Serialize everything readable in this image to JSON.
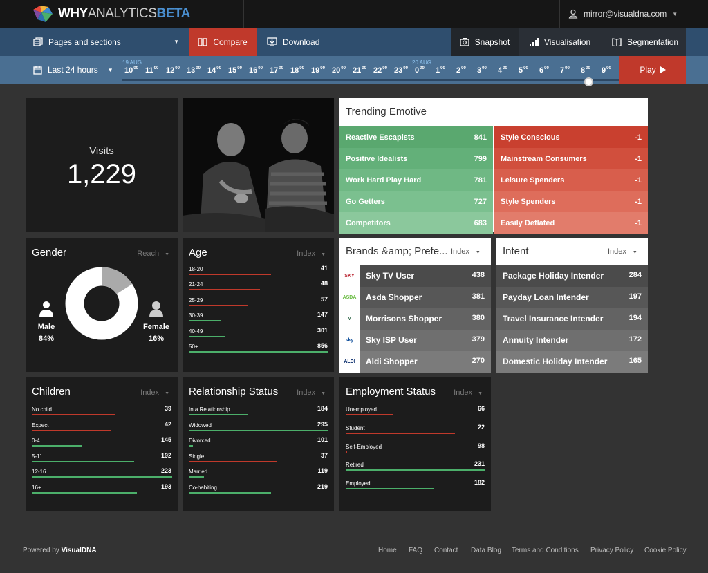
{
  "header": {
    "logo": {
      "why": "WHY",
      "analytics": "ANALYTICS",
      "beta": "BETA"
    },
    "user_email": "mirror@visualdna.com"
  },
  "nav": {
    "pages": "Pages and sections",
    "compare": "Compare",
    "download": "Download",
    "snapshot": "Snapshot",
    "visualisation": "Visualisation",
    "segmentation": "Segmentation"
  },
  "timebar": {
    "range": "Last 24 hours",
    "date1": "19 AUG",
    "date2": "20 AUG",
    "hours": [
      "10",
      "11",
      "12",
      "13",
      "14",
      "15",
      "16",
      "17",
      "18",
      "19",
      "20",
      "21",
      "22",
      "23",
      "0",
      "1",
      "2",
      "3",
      "4",
      "5",
      "6",
      "7",
      "8",
      "9"
    ],
    "minute_suffix": "00",
    "play": "Play"
  },
  "visits": {
    "label": "Visits",
    "value": "1,229"
  },
  "trending": {
    "title": "Trending Emotive",
    "positive": [
      {
        "name": "Reactive Escapists",
        "value": "841",
        "color": "#5aa86f"
      },
      {
        "name": "Positive Idealists",
        "value": "799",
        "color": "#63b079"
      },
      {
        "name": "Work Hard Play Hard",
        "value": "781",
        "color": "#6fb884"
      },
      {
        "name": "Go Getters",
        "value": "727",
        "color": "#7bc08f"
      },
      {
        "name": "Competitors",
        "value": "683",
        "color": "#8bc89c"
      }
    ],
    "negative": [
      {
        "name": "Style Conscious",
        "value": "-1",
        "color": "#c9402f"
      },
      {
        "name": "Mainstream Consumers",
        "value": "-1",
        "color": "#d14f3d"
      },
      {
        "name": "Leisure Spenders",
        "value": "-1",
        "color": "#d85e4c"
      },
      {
        "name": "Style Spenders",
        "value": "-1",
        "color": "#de6d5b"
      },
      {
        "name": "Easily Deflated",
        "value": "-1",
        "color": "#e27c6b"
      }
    ]
  },
  "gender": {
    "title": "Gender",
    "meta": "Reach",
    "male_label": "Male",
    "male_pct": "84%",
    "male_value": 84,
    "female_label": "Female",
    "female_pct": "16%",
    "female_value": 16
  },
  "age": {
    "title": "Age",
    "meta": "Index",
    "rows": [
      {
        "label": "18-20",
        "value": "41",
        "fill": 0.59,
        "color": "#c0392b"
      },
      {
        "label": "21-24",
        "value": "48",
        "fill": 0.51,
        "color": "#c0392b"
      },
      {
        "label": "25-29",
        "value": "57",
        "fill": 0.42,
        "color": "#c0392b"
      },
      {
        "label": "30-39",
        "value": "147",
        "fill": 0.23,
        "color": "#4caf6a"
      },
      {
        "label": "40-49",
        "value": "301",
        "fill": 0.26,
        "color": "#4caf6a"
      },
      {
        "label": "50+",
        "value": "856",
        "fill": 1.0,
        "color": "#4caf6a"
      }
    ]
  },
  "brands": {
    "title": "Brands &amp; Prefe...",
    "meta": "Index",
    "rows": [
      {
        "logo": "SKY",
        "name": "Sky TV User",
        "value": "438",
        "bg": "#4b4b4b"
      },
      {
        "logo": "ASDA",
        "name": "Asda Shopper",
        "value": "381",
        "bg": "#575757"
      },
      {
        "logo": "M",
        "name": "Morrisons Shopper",
        "value": "380",
        "bg": "#636363"
      },
      {
        "logo": "sky",
        "name": "Sky ISP User",
        "value": "379",
        "bg": "#6f6f6f"
      },
      {
        "logo": "ALDI",
        "name": "Aldi Shopper",
        "value": "270",
        "bg": "#7b7b7b"
      }
    ]
  },
  "intent": {
    "title": "Intent",
    "meta": "Index",
    "rows": [
      {
        "name": "Package Holiday Intender",
        "value": "284",
        "bg": "#4b4b4b"
      },
      {
        "name": "Payday Loan Intender",
        "value": "197",
        "bg": "#575757"
      },
      {
        "name": "Travel Insurance Intender",
        "value": "194",
        "bg": "#636363"
      },
      {
        "name": "Annuity Intender",
        "value": "172",
        "bg": "#6f6f6f"
      },
      {
        "name": "Domestic Holiday Intender",
        "value": "165",
        "bg": "#7b7b7b"
      }
    ]
  },
  "children": {
    "title": "Children",
    "meta": "Index",
    "rows": [
      {
        "label": "No child",
        "value": "39",
        "fill": 0.59,
        "color": "#c0392b"
      },
      {
        "label": "Expect",
        "value": "42",
        "fill": 0.56,
        "color": "#c0392b"
      },
      {
        "label": "0-4",
        "value": "145",
        "fill": 0.36,
        "color": "#4caf6a"
      },
      {
        "label": "5-11",
        "value": "192",
        "fill": 0.73,
        "color": "#4caf6a"
      },
      {
        "label": "12-16",
        "value": "223",
        "fill": 1.0,
        "color": "#4caf6a"
      },
      {
        "label": "16+",
        "value": "193",
        "fill": 0.75,
        "color": "#4caf6a"
      }
    ]
  },
  "relationship": {
    "title": "Relationship Status",
    "meta": "Index",
    "rows": [
      {
        "label": "In a Relationship",
        "value": "184",
        "fill": 0.42,
        "color": "#4caf6a"
      },
      {
        "label": "Widowed",
        "value": "295",
        "fill": 1.0,
        "color": "#4caf6a"
      },
      {
        "label": "Divorced",
        "value": "101",
        "fill": 0.03,
        "color": "#4caf6a"
      },
      {
        "label": "Single",
        "value": "37",
        "fill": 0.63,
        "color": "#c0392b"
      },
      {
        "label": "Married",
        "value": "119",
        "fill": 0.11,
        "color": "#4caf6a"
      },
      {
        "label": "Co-habiting",
        "value": "219",
        "fill": 0.59,
        "color": "#4caf6a"
      }
    ]
  },
  "employment": {
    "title": "Employment Status",
    "meta": "Index",
    "rows": [
      {
        "label": "Unemployed",
        "value": "66",
        "fill": 0.34,
        "color": "#c0392b"
      },
      {
        "label": "Student",
        "value": "22",
        "fill": 0.78,
        "color": "#c0392b"
      },
      {
        "label": "Self-Employed",
        "value": "98",
        "fill": 0.01,
        "color": "#c0392b"
      },
      {
        "label": "Retired",
        "value": "231",
        "fill": 1.0,
        "color": "#4caf6a"
      },
      {
        "label": "Employed",
        "value": "182",
        "fill": 0.63,
        "color": "#4caf6a"
      }
    ]
  },
  "footer": {
    "powered_by": "Powered by",
    "brand": "VisualDNA",
    "links": [
      "Home",
      "FAQ",
      "Contact",
      "Data Blog",
      "Terms and Conditions",
      "Privacy Policy",
      "Cookie Policy"
    ]
  }
}
